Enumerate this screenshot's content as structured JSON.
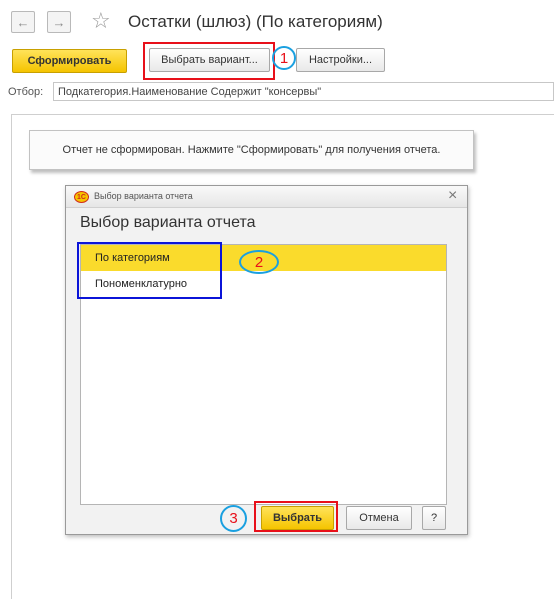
{
  "window": {
    "title": "Остатки (шлюз) (По категориям)",
    "back_icon": "←",
    "forward_icon": "→",
    "favorite_icon": "☆"
  },
  "toolbar": {
    "generate_label": "Сформировать",
    "choose_variant_label": "Выбрать вариант...",
    "settings_label": "Настройки..."
  },
  "filter": {
    "label": "Отбор:",
    "value": "Подкатегория.Наименование Содержит \"консервы\""
  },
  "report": {
    "not_generated_message": "Отчет не сформирован. Нажмите \"Сформировать\" для получения отчета."
  },
  "dialog": {
    "caption": "Выбор варианта отчета",
    "heading": "Выбор варианта отчета",
    "app_icon_text": "1С",
    "close_icon": "×",
    "variants": [
      {
        "label": "По категориям",
        "selected": true
      },
      {
        "label": "Пономенклатурно",
        "selected": false
      }
    ],
    "select_label": "Выбрать",
    "cancel_label": "Отмена",
    "help_label": "?"
  },
  "annotations": {
    "marker_1": "1",
    "marker_2": "2",
    "marker_3": "3"
  },
  "colors": {
    "accent_yellow": "#f5c400",
    "selection_yellow": "#fadb2c",
    "highlight_red": "#e8101a",
    "highlight_blue": "#0b14d8",
    "marker_cyan": "#1aa0e0"
  }
}
